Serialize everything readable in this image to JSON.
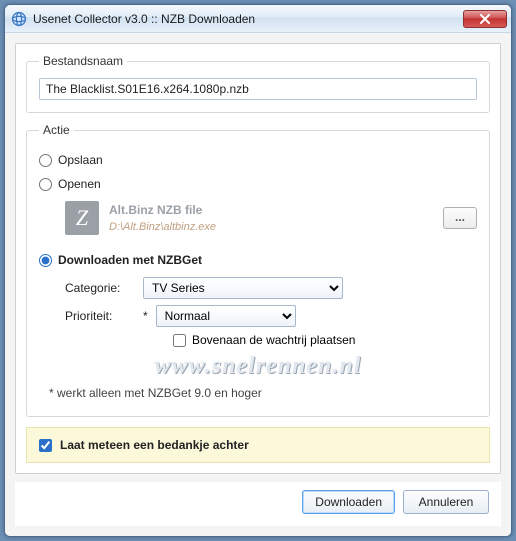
{
  "window": {
    "title": "Usenet Collector v3.0 :: NZB Downloaden"
  },
  "filename_group": {
    "legend": "Bestandsnaam",
    "value": "The Blacklist.S01E16.x264.1080p.nzb"
  },
  "action_group": {
    "legend": "Actie",
    "save_label": "Opslaan",
    "open_label": "Openen",
    "app": {
      "icon_letter": "Z",
      "name": "Alt.Binz NZB file",
      "path": "D:\\Alt.Binz\\altbinz.exe",
      "browse_label": "..."
    },
    "nzbget": {
      "label": "Downloaden met NZBGet",
      "category_label": "Categorie:",
      "category_value": "TV Series",
      "priority_label": "Prioriteit:",
      "priority_value": "Normaal",
      "star": "*",
      "top_queue_label": "Bovenaan de wachtrij plaatsen"
    },
    "watermark": "www.snelrennen.nl",
    "footnote": "* werkt alleen met NZBGet 9.0 en hoger"
  },
  "thanks": {
    "checked": true,
    "label": "Laat meteen een bedankje achter"
  },
  "footer": {
    "download_label": "Downloaden",
    "cancel_label": "Annuleren"
  }
}
